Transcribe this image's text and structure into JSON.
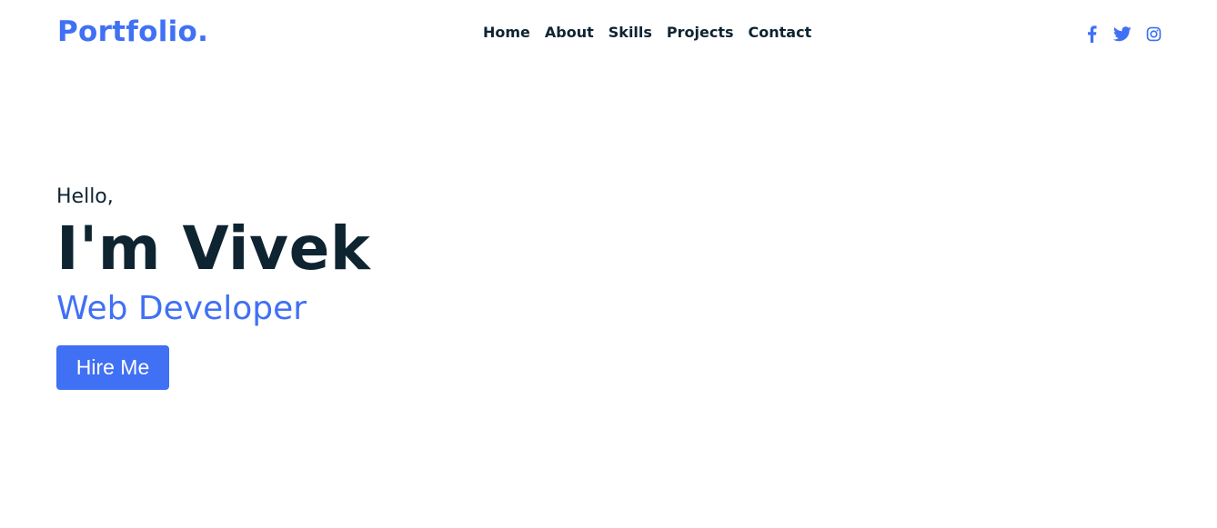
{
  "brand": {
    "logo_text": "Portfolio."
  },
  "nav": {
    "items": [
      {
        "label": "Home"
      },
      {
        "label": "About"
      },
      {
        "label": "Skills"
      },
      {
        "label": "Projects"
      },
      {
        "label": "Contact"
      }
    ]
  },
  "socials": [
    {
      "icon": "facebook-icon"
    },
    {
      "icon": "twitter-icon"
    },
    {
      "icon": "instagram-icon"
    }
  ],
  "hero": {
    "greeting": "Hello,",
    "name": "I'm Vivek",
    "role": "Web Developer",
    "cta_label": "Hire Me"
  },
  "colors": {
    "accent": "#4070f4",
    "text_dark": "#0e2431",
    "background": "#ffffff"
  }
}
